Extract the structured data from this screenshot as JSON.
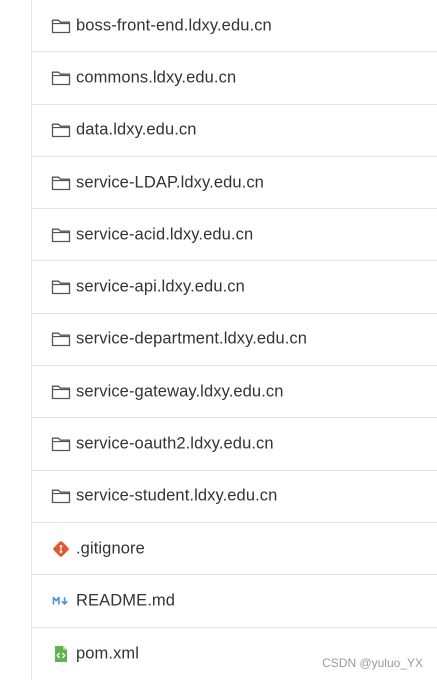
{
  "file_list": {
    "items": [
      {
        "name": "boss-front-end.ldxy.edu.cn",
        "icon": "folder-icon"
      },
      {
        "name": "commons.ldxy.edu.cn",
        "icon": "folder-icon"
      },
      {
        "name": "data.ldxy.edu.cn",
        "icon": "folder-icon"
      },
      {
        "name": "service-LDAP.ldxy.edu.cn",
        "icon": "folder-icon"
      },
      {
        "name": "service-acid.ldxy.edu.cn",
        "icon": "folder-icon"
      },
      {
        "name": "service-api.ldxy.edu.cn",
        "icon": "folder-icon"
      },
      {
        "name": "service-department.ldxy.edu.cn",
        "icon": "folder-icon"
      },
      {
        "name": "service-gateway.ldxy.edu.cn",
        "icon": "folder-icon"
      },
      {
        "name": "service-oauth2.ldxy.edu.cn",
        "icon": "folder-icon"
      },
      {
        "name": "service-student.ldxy.edu.cn",
        "icon": "folder-icon"
      },
      {
        "name": ".gitignore",
        "icon": "git-icon"
      },
      {
        "name": "README.md",
        "icon": "markdown-icon"
      },
      {
        "name": "pom.xml",
        "icon": "xml-file-icon"
      }
    ]
  },
  "watermark": "CSDN @yuluo_YX",
  "colors": {
    "folder_stroke": "#555555",
    "git_orange": "#e8552f",
    "markdown_blue": "#4f8ed8",
    "xml_green": "#5fb34a",
    "text": "#333333",
    "divider": "#e6e6e6"
  }
}
